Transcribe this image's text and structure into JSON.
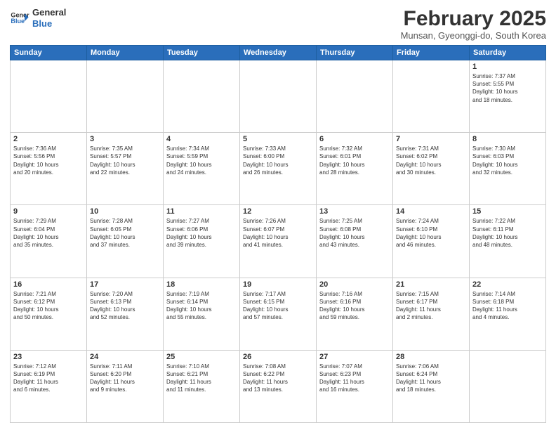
{
  "header": {
    "logo_general": "General",
    "logo_blue": "Blue",
    "month_year": "February 2025",
    "location": "Munsan, Gyeonggi-do, South Korea"
  },
  "weekdays": [
    "Sunday",
    "Monday",
    "Tuesday",
    "Wednesday",
    "Thursday",
    "Friday",
    "Saturday"
  ],
  "weeks": [
    [
      {
        "day": "",
        "info": ""
      },
      {
        "day": "",
        "info": ""
      },
      {
        "day": "",
        "info": ""
      },
      {
        "day": "",
        "info": ""
      },
      {
        "day": "",
        "info": ""
      },
      {
        "day": "",
        "info": ""
      },
      {
        "day": "1",
        "info": "Sunrise: 7:37 AM\nSunset: 5:55 PM\nDaylight: 10 hours\nand 18 minutes."
      }
    ],
    [
      {
        "day": "2",
        "info": "Sunrise: 7:36 AM\nSunset: 5:56 PM\nDaylight: 10 hours\nand 20 minutes."
      },
      {
        "day": "3",
        "info": "Sunrise: 7:35 AM\nSunset: 5:57 PM\nDaylight: 10 hours\nand 22 minutes."
      },
      {
        "day": "4",
        "info": "Sunrise: 7:34 AM\nSunset: 5:59 PM\nDaylight: 10 hours\nand 24 minutes."
      },
      {
        "day": "5",
        "info": "Sunrise: 7:33 AM\nSunset: 6:00 PM\nDaylight: 10 hours\nand 26 minutes."
      },
      {
        "day": "6",
        "info": "Sunrise: 7:32 AM\nSunset: 6:01 PM\nDaylight: 10 hours\nand 28 minutes."
      },
      {
        "day": "7",
        "info": "Sunrise: 7:31 AM\nSunset: 6:02 PM\nDaylight: 10 hours\nand 30 minutes."
      },
      {
        "day": "8",
        "info": "Sunrise: 7:30 AM\nSunset: 6:03 PM\nDaylight: 10 hours\nand 32 minutes."
      }
    ],
    [
      {
        "day": "9",
        "info": "Sunrise: 7:29 AM\nSunset: 6:04 PM\nDaylight: 10 hours\nand 35 minutes."
      },
      {
        "day": "10",
        "info": "Sunrise: 7:28 AM\nSunset: 6:05 PM\nDaylight: 10 hours\nand 37 minutes."
      },
      {
        "day": "11",
        "info": "Sunrise: 7:27 AM\nSunset: 6:06 PM\nDaylight: 10 hours\nand 39 minutes."
      },
      {
        "day": "12",
        "info": "Sunrise: 7:26 AM\nSunset: 6:07 PM\nDaylight: 10 hours\nand 41 minutes."
      },
      {
        "day": "13",
        "info": "Sunrise: 7:25 AM\nSunset: 6:08 PM\nDaylight: 10 hours\nand 43 minutes."
      },
      {
        "day": "14",
        "info": "Sunrise: 7:24 AM\nSunset: 6:10 PM\nDaylight: 10 hours\nand 46 minutes."
      },
      {
        "day": "15",
        "info": "Sunrise: 7:22 AM\nSunset: 6:11 PM\nDaylight: 10 hours\nand 48 minutes."
      }
    ],
    [
      {
        "day": "16",
        "info": "Sunrise: 7:21 AM\nSunset: 6:12 PM\nDaylight: 10 hours\nand 50 minutes."
      },
      {
        "day": "17",
        "info": "Sunrise: 7:20 AM\nSunset: 6:13 PM\nDaylight: 10 hours\nand 52 minutes."
      },
      {
        "day": "18",
        "info": "Sunrise: 7:19 AM\nSunset: 6:14 PM\nDaylight: 10 hours\nand 55 minutes."
      },
      {
        "day": "19",
        "info": "Sunrise: 7:17 AM\nSunset: 6:15 PM\nDaylight: 10 hours\nand 57 minutes."
      },
      {
        "day": "20",
        "info": "Sunrise: 7:16 AM\nSunset: 6:16 PM\nDaylight: 10 hours\nand 59 minutes."
      },
      {
        "day": "21",
        "info": "Sunrise: 7:15 AM\nSunset: 6:17 PM\nDaylight: 11 hours\nand 2 minutes."
      },
      {
        "day": "22",
        "info": "Sunrise: 7:14 AM\nSunset: 6:18 PM\nDaylight: 11 hours\nand 4 minutes."
      }
    ],
    [
      {
        "day": "23",
        "info": "Sunrise: 7:12 AM\nSunset: 6:19 PM\nDaylight: 11 hours\nand 6 minutes."
      },
      {
        "day": "24",
        "info": "Sunrise: 7:11 AM\nSunset: 6:20 PM\nDaylight: 11 hours\nand 9 minutes."
      },
      {
        "day": "25",
        "info": "Sunrise: 7:10 AM\nSunset: 6:21 PM\nDaylight: 11 hours\nand 11 minutes."
      },
      {
        "day": "26",
        "info": "Sunrise: 7:08 AM\nSunset: 6:22 PM\nDaylight: 11 hours\nand 13 minutes."
      },
      {
        "day": "27",
        "info": "Sunrise: 7:07 AM\nSunset: 6:23 PM\nDaylight: 11 hours\nand 16 minutes."
      },
      {
        "day": "28",
        "info": "Sunrise: 7:06 AM\nSunset: 6:24 PM\nDaylight: 11 hours\nand 18 minutes."
      },
      {
        "day": "",
        "info": ""
      }
    ]
  ]
}
